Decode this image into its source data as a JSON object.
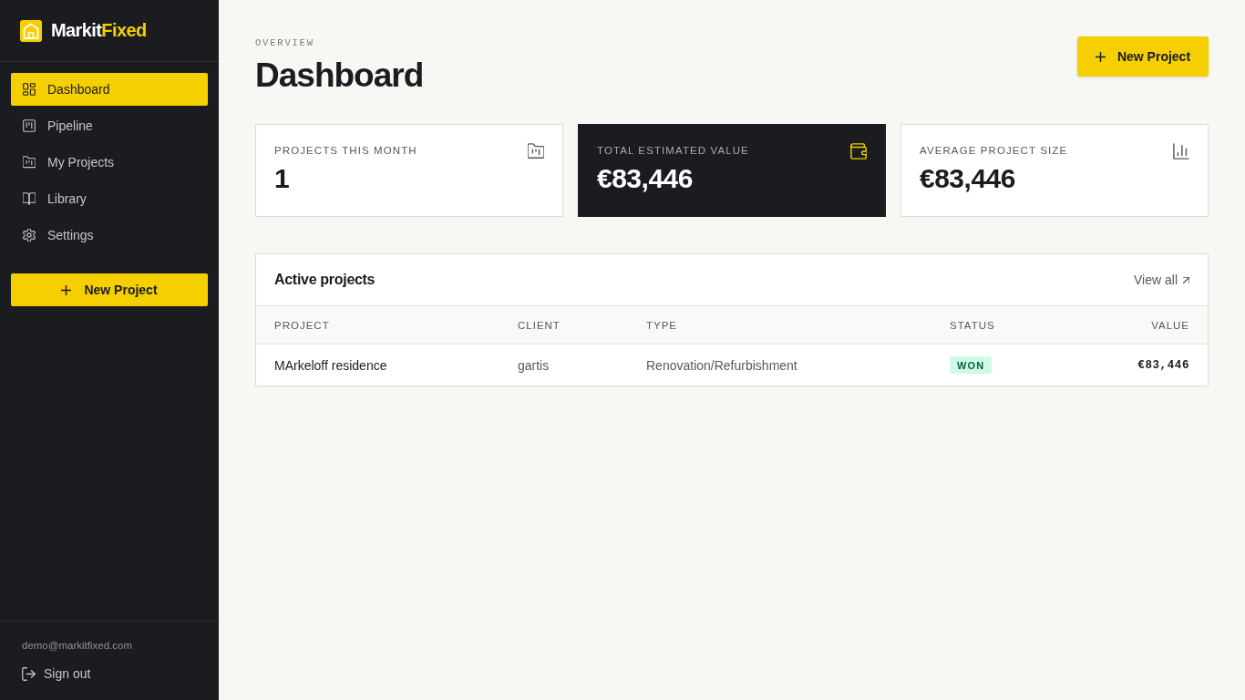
{
  "sidebar": {
    "brand": {
      "name": "Markit",
      "highlight": "Fixed"
    },
    "nav_items": [
      {
        "label": "Dashboard",
        "selected": true
      },
      {
        "label": "Pipeline",
        "selected": false
      },
      {
        "label": "My Projects",
        "selected": false
      },
      {
        "label": "Library",
        "selected": false
      },
      {
        "label": "Settings",
        "selected": false
      }
    ],
    "new_project_button": "New Project",
    "user_email": "demo@markitfixed.com",
    "sign_out": "Sign out"
  },
  "header": {
    "eyebrow": "OVERVIEW",
    "title": "Dashboard",
    "new_project_button": "New Project"
  },
  "stats": [
    {
      "label": "PROJECTS THIS MONTH",
      "value": "1",
      "kind": "light"
    },
    {
      "label": "TOTAL ESTIMATED VALUE",
      "value": "€83,446",
      "kind": "dark"
    },
    {
      "label": "AVERAGE PROJECT SIZE",
      "value": "€83,446",
      "kind": "light"
    }
  ],
  "table": {
    "title": "Active projects",
    "view_all": "View all",
    "columns": [
      "PROJECT",
      "CLIENT",
      "TYPE",
      "STATUS",
      "VALUE"
    ],
    "rows": [
      {
        "project": "MArkeloff residence",
        "client": "gartis",
        "type": "Renovation/Refurbishment",
        "status": "WON",
        "value": "€83,446"
      }
    ]
  }
}
